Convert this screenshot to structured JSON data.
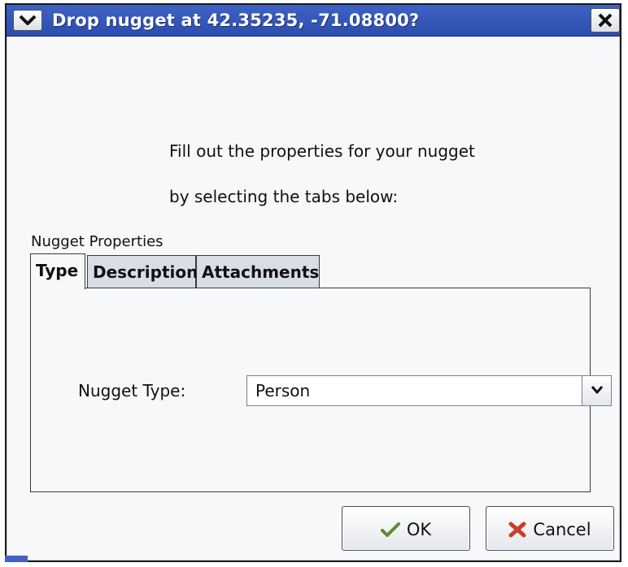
{
  "window": {
    "title": "Drop nugget at 42.35235, -71.08800?",
    "menu_icon": "chevron-down-icon",
    "close_icon": "close-icon"
  },
  "prompt": {
    "line1": "Fill out the properties for your nugget",
    "line2": "by selecting the tabs below:"
  },
  "group": {
    "label": "Nugget Properties"
  },
  "tabs": [
    {
      "label": "Type",
      "active": true
    },
    {
      "label": "Description",
      "active": false
    },
    {
      "label": "Attachments",
      "active": false
    }
  ],
  "type_tab": {
    "field_label": "Nugget Type:",
    "selected_value": "Person"
  },
  "buttons": {
    "ok_label": "OK",
    "cancel_label": "Cancel"
  },
  "colors": {
    "titlebar": "#2b4dae",
    "ok_check": "#5f8a2a",
    "cancel_x": "#c8402a"
  }
}
